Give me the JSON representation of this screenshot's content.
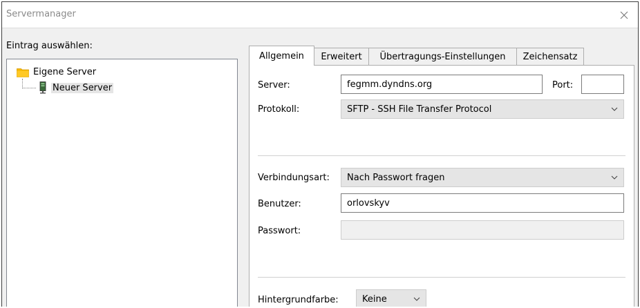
{
  "window": {
    "title": "Servermanager"
  },
  "left": {
    "label": "Eintrag auswählen:",
    "tree": {
      "root": "Eigene Server",
      "child": "Neuer Server"
    }
  },
  "tabs": [
    {
      "label": "Allgemein",
      "active": true
    },
    {
      "label": "Erweitert"
    },
    {
      "label": "Übertragungs-Einstellungen"
    },
    {
      "label": "Zeichensatz"
    }
  ],
  "form": {
    "server_label": "Server:",
    "server_value": "fegmm.dyndns.org",
    "port_label": "Port:",
    "port_value": "",
    "protocol_label": "Protokoll:",
    "protocol_value": "SFTP - SSH File Transfer Protocol",
    "logon_label": "Verbindungsart:",
    "logon_value": "Nach Passwort fragen",
    "user_label": "Benutzer:",
    "user_value": "orlovskyv",
    "password_label": "Passwort:",
    "password_value": "",
    "bgcolor_label": "Hintergrundfarbe:",
    "bgcolor_value": "Keine"
  },
  "colors": {
    "folder": "#f5b800",
    "server_icon": "#3a6b3a"
  }
}
